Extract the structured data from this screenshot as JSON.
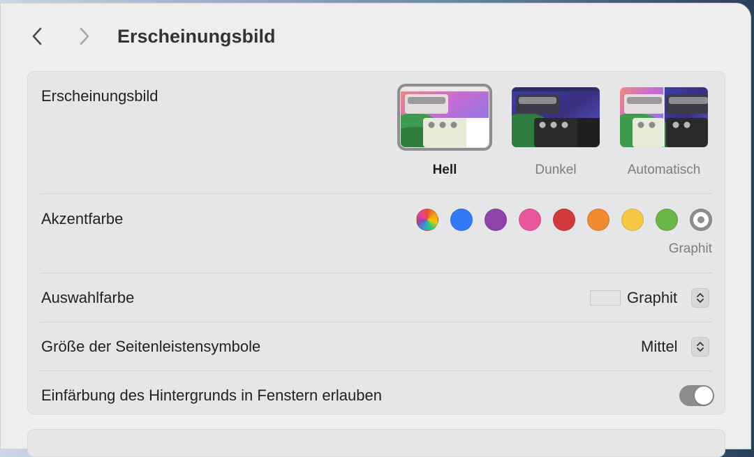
{
  "window": {
    "title": "Erscheinungsbild"
  },
  "appearance": {
    "label": "Erscheinungsbild",
    "options": [
      {
        "label": "Hell",
        "selected": true
      },
      {
        "label": "Dunkel",
        "selected": false
      },
      {
        "label": "Automatisch",
        "selected": false
      }
    ]
  },
  "accent": {
    "label": "Akzentfarbe",
    "colors": [
      {
        "name": "Multicolor",
        "hex": "multicolor"
      },
      {
        "name": "Blue",
        "hex": "#3478f6"
      },
      {
        "name": "Purple",
        "hex": "#8e44a8"
      },
      {
        "name": "Pink",
        "hex": "#e8579b"
      },
      {
        "name": "Red",
        "hex": "#d33a3d"
      },
      {
        "name": "Orange",
        "hex": "#ee8a2f"
      },
      {
        "name": "Yellow",
        "hex": "#f6c844"
      },
      {
        "name": "Green",
        "hex": "#6cb548"
      },
      {
        "name": "Graphite",
        "hex": "#8f8f92",
        "selected": true
      }
    ],
    "selected_caption": "Graphit"
  },
  "selection_color": {
    "label": "Auswahlfarbe",
    "value": "Graphit",
    "swatch": "#e4e4e6"
  },
  "sidebar_icon_size": {
    "label": "Größe der Seitenleistensymbole",
    "value": "Mittel"
  },
  "wallpaper_tinting": {
    "label": "Einfärbung des Hintergrunds in Fenstern erlauben",
    "enabled": true
  }
}
